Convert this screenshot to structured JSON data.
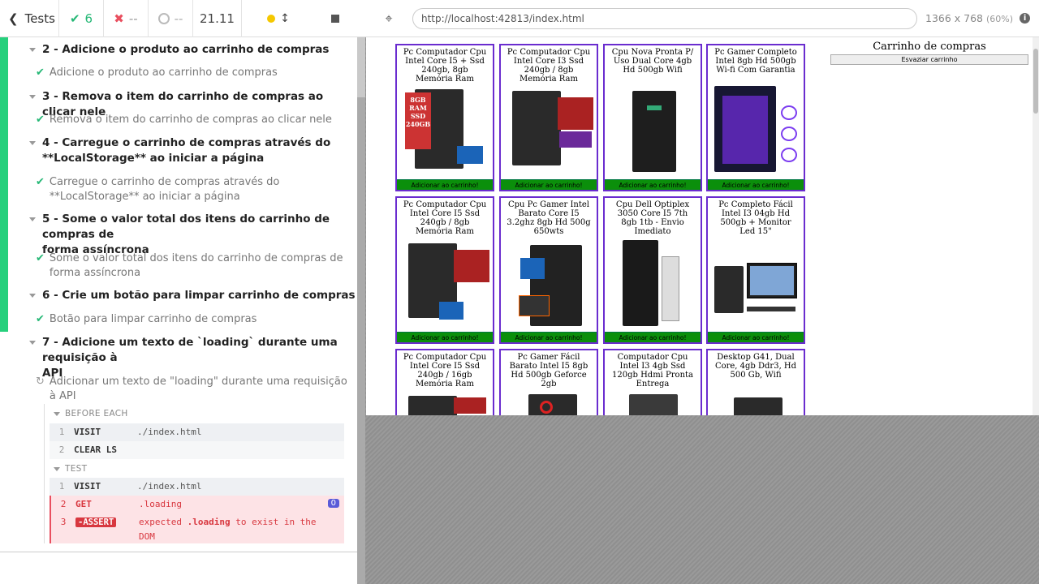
{
  "topbar": {
    "tests_label": "Tests",
    "passed": "6",
    "failed": "--",
    "pending": "--",
    "duration": "21.11"
  },
  "suites": [
    {
      "title": "2 - Adicione o produto ao carrinho de compras",
      "test": "Adicione o produto ao carrinho de compras"
    },
    {
      "title": "3 - Remova o item do carrinho de compras ao clicar nele",
      "test": "Remova o item do carrinho de compras ao clicar nele"
    },
    {
      "title_l1": "4 - Carregue o carrinho de compras através do",
      "title_l2": "**LocalStorage** ao iniciar a página",
      "test_l1": "Carregue o carrinho de compras através do",
      "test_l2": "**LocalStorage** ao iniciar a página"
    },
    {
      "title_l1": "5 - Some o valor total dos itens do carrinho de compras de",
      "title_l2": "forma assíncrona",
      "test_l1": "Some o valor total dos itens do carrinho de compras de",
      "test_l2": "forma assíncrona"
    },
    {
      "title": "6 - Crie um botão para limpar carrinho de compras",
      "test": "Botão para limpar carrinho de compras"
    },
    {
      "title_l1": "7 - Adicione um texto de `loading` durante uma requisição à",
      "title_l2": "API",
      "test_l1": "Adicionar um texto de \"loading\" durante uma requisição",
      "test_l2": "à API"
    }
  ],
  "hooks": {
    "before_each": "BEFORE EACH",
    "test": "TEST"
  },
  "commands": {
    "be1": {
      "num": "1",
      "name": "VISIT",
      "msg": "./index.html"
    },
    "be2": {
      "num": "2",
      "name": "CLEAR LS",
      "msg": ""
    },
    "t1": {
      "num": "1",
      "name": "VISIT",
      "msg": "./index.html"
    },
    "t2": {
      "num": "2",
      "name": "GET",
      "msg": ".loading",
      "badge": "0"
    },
    "t3": {
      "num": "3",
      "name": "-ASSERT",
      "msg_a": "expected ",
      "msg_b": ".loading",
      "msg_c": " to exist in the",
      "msg_d": "DOM"
    }
  },
  "runner": {
    "url": "http://localhost:42813/index.html",
    "viewport": "1366 x 768",
    "zoom": "(60%)"
  },
  "app": {
    "cart_title": "Carrinho de compras",
    "cart_clear": "Esvaziar carrinho",
    "add_label": "Adicionar ao carrinho!",
    "products": [
      "Pc Computador Cpu Intel Core I5 + Ssd 240gb, 8gb Memória Ram",
      "Pc Computador Cpu Intel Core I3 Ssd 240gb / 8gb Memória Ram",
      "Cpu Nova Pronta P/ Uso Dual Core 4gb Hd 500gb Wifi",
      "Pc Gamer Completo Intel 8gb Hd 500gb Wi-fi Com Garantia",
      "Pc Computador Cpu Intel Core I5 Ssd 240gb / 8gb Memória Ram",
      "Cpu Pc Gamer Intel Barato Core I5 3.2ghz 8gb Hd 500g 650wts",
      "Cpu Dell Optiplex 3050 Core I5 7th 8gb 1tb - Envio Imediato",
      "Pc Completo Fácil Intel I3 04gb Hd 500gb + Monitor Led 15\"",
      "Pc Computador Cpu Intel Core I5 Ssd 240gb / 16gb Memória Ram",
      "Pc Gamer Fácil Barato Intel I5 8gb Hd 500gb Geforce 2gb",
      "Computador Cpu Intel I3 4gb Ssd 120gb Hdmi Pronta Entrega",
      "Desktop G41, Dual Core, 4gb Ddr3, Hd 500 Gb, Wifi"
    ],
    "pic1": {
      "ram": "8GB RAM",
      "ssd": "SSD 240GB"
    }
  }
}
